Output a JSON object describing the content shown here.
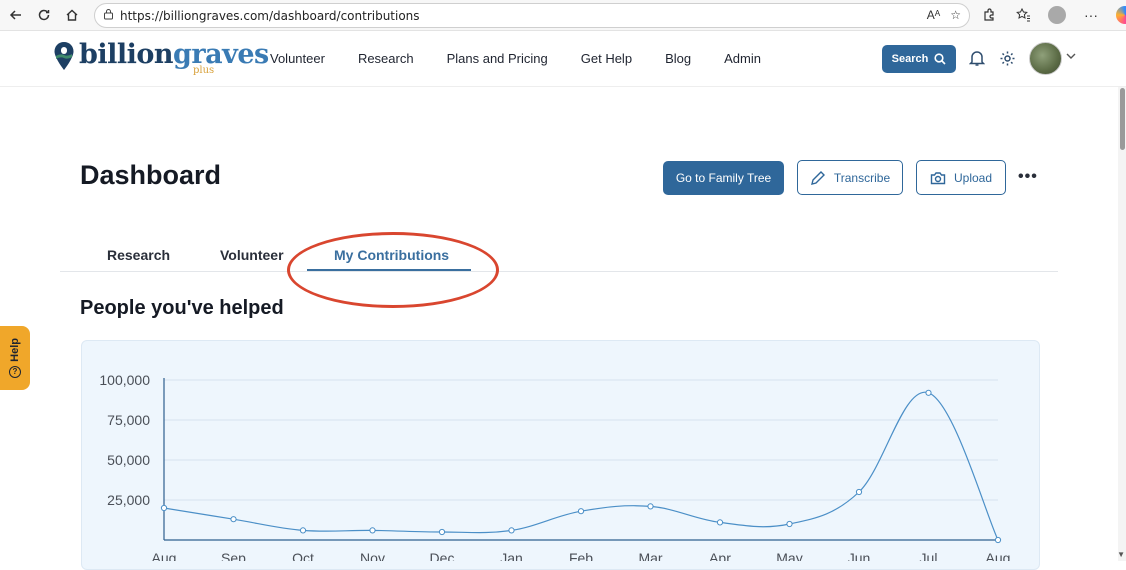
{
  "browser": {
    "url": "https://billiongraves.com/dashboard/contributions",
    "read_aloud_label": "Aᴬ"
  },
  "header": {
    "logo_text_1": "billion",
    "logo_text_2": "graves",
    "logo_sub": "plus",
    "nav": [
      "Volunteer",
      "Research",
      "Plans and Pricing",
      "Get Help",
      "Blog",
      "Admin"
    ],
    "search_label": "Search"
  },
  "page": {
    "title": "Dashboard",
    "buttons": {
      "family_tree": "Go to Family Tree",
      "transcribe": "Transcribe",
      "upload": "Upload",
      "more": "•••"
    },
    "tabs": [
      "Research",
      "Volunteer",
      "My Contributions"
    ],
    "active_tab": "My Contributions",
    "section_title": "People you've helped",
    "help_label": "Help"
  },
  "colors": {
    "primary": "#2f679a",
    "line": "#4b8fc7",
    "annotation": "#d9462f",
    "help_tab": "#f0a72a"
  },
  "chart_data": {
    "type": "line",
    "title": "",
    "xlabel": "",
    "ylabel": "",
    "categories": [
      "Aug",
      "Sep",
      "Oct",
      "Nov",
      "Dec",
      "Jan",
      "Feb",
      "Mar",
      "Apr",
      "May",
      "Jun",
      "Jul",
      "Aug"
    ],
    "series": [
      {
        "values": [
          20000,
          13000,
          6000,
          6000,
          5000,
          6000,
          18000,
          21000,
          11000,
          10000,
          30000,
          92000,
          0
        ]
      }
    ],
    "yticks": [
      25000,
      50000,
      75000,
      100000
    ],
    "ytick_labels": [
      "25,000",
      "50,000",
      "75,000",
      "100,000"
    ],
    "ylim": [
      0,
      100000
    ],
    "grid": true
  }
}
